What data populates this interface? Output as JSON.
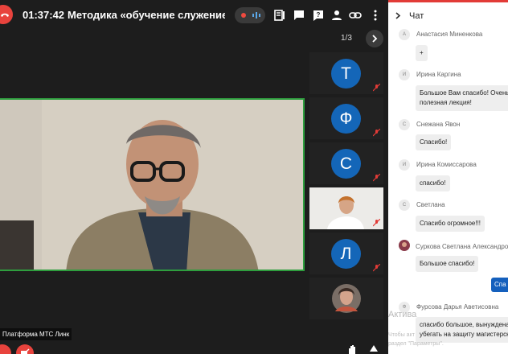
{
  "meeting": {
    "timer": "01:37:42",
    "title": "Методика «обучение служением»: пр",
    "pager": "1/3",
    "brand_label": "Платформа МТС Линк"
  },
  "participants": [
    {
      "initial": "Т",
      "muted": true
    },
    {
      "initial": "Ф",
      "muted": true
    },
    {
      "initial": "С",
      "muted": true
    },
    {
      "initial": "",
      "video": true,
      "muted": true
    },
    {
      "initial": "Л",
      "muted": true
    },
    {
      "initial": "",
      "photo": true,
      "muted": false
    }
  ],
  "chat": {
    "title": "Чат",
    "messages": [
      {
        "initial": "А",
        "author": "Анастасия Миненкова",
        "lines": [
          "+"
        ]
      },
      {
        "initial": "И",
        "author": "Ирина Каргина",
        "lines": [
          "Большое Вам спасибо! Очень",
          "полезная лекция!"
        ]
      },
      {
        "initial": "С",
        "author": "Снежана Явон",
        "lines": [
          "Спасибо!"
        ]
      },
      {
        "initial": "И",
        "author": "Ирина Комиссарова",
        "lines": [
          "спасибо!"
        ]
      },
      {
        "initial": "С",
        "author": "Светлана",
        "lines": [
          "Спасибо огромное!!!"
        ]
      },
      {
        "initial": "",
        "author": "Суркова Светлана Александровна",
        "lines": [
          "Большое спасибо!"
        ]
      },
      {
        "initial": "Ф",
        "author": "Фурсова Дарья Аветисовна",
        "lines": [
          "спасибо большое, вынуждена",
          "убегать на защиту магистерских"
        ]
      }
    ],
    "own_message": "Спа",
    "watermark_title": "Актива",
    "watermark_text": "Чтобы акт",
    "watermark_text2": "раздел \"Параметры\"."
  },
  "colors": {
    "accent_red": "#e8433d",
    "active_speaker_border": "#2e9e3e",
    "avatar_blue": "#1466b8",
    "own_bubble": "#1560bd"
  }
}
